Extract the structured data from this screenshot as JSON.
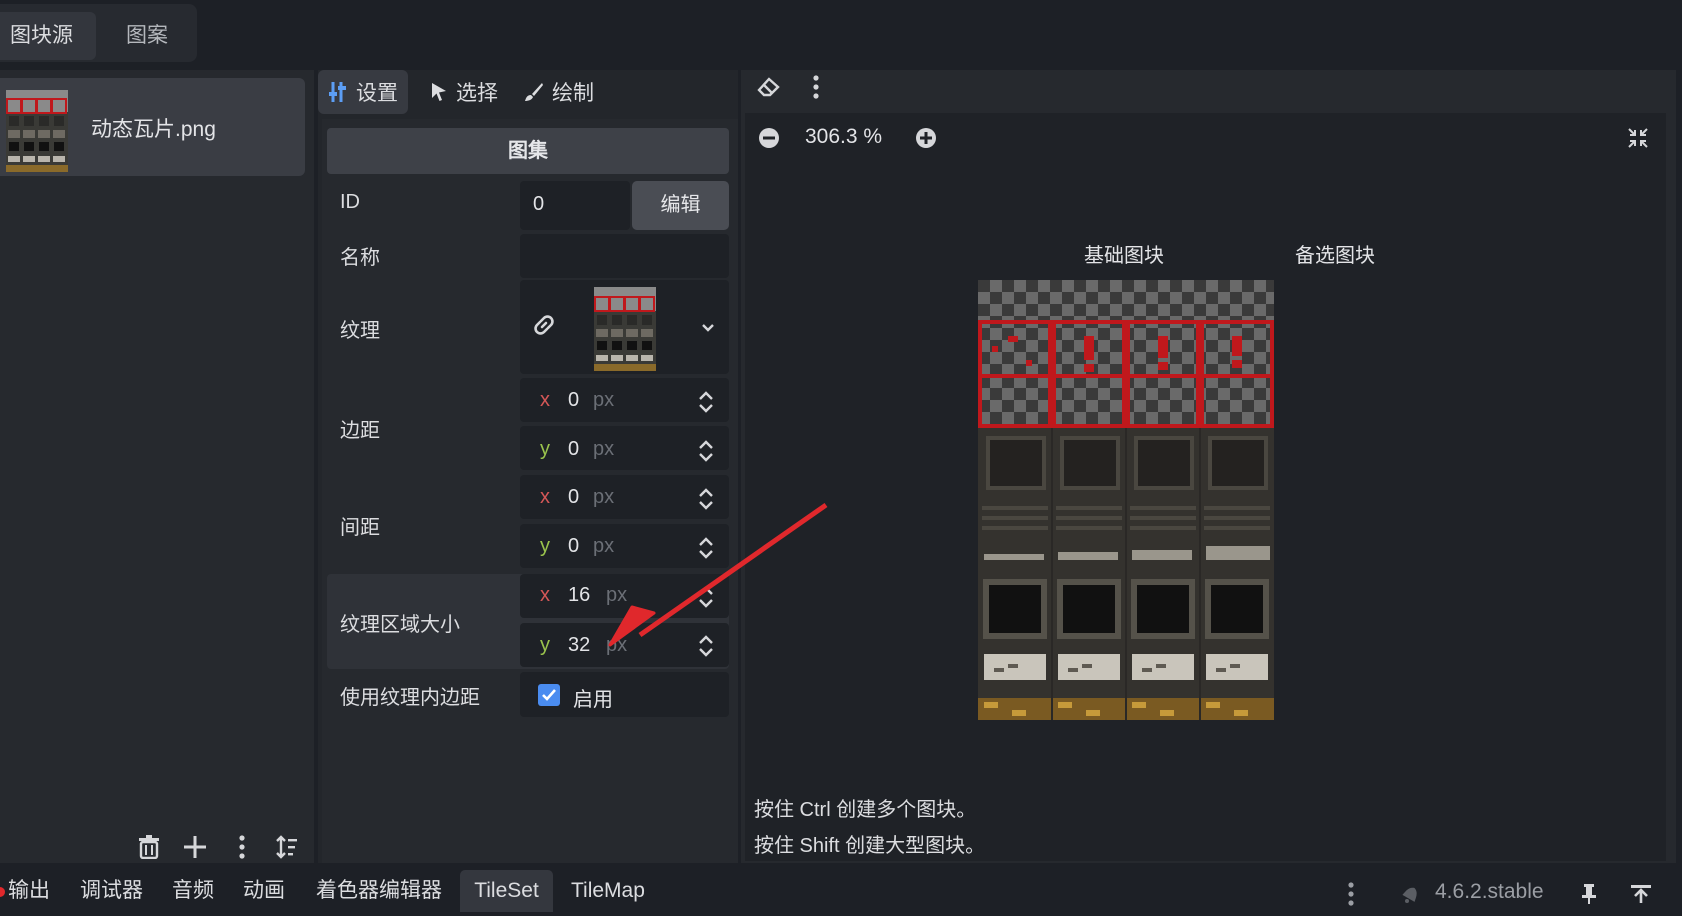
{
  "source_tabs": [
    "图块源",
    "图案"
  ],
  "atlas": {
    "name": "动态瓦片.png"
  },
  "left_toolbar": {
    "icons": [
      "trash-icon",
      "plus-icon",
      "kebab-icon",
      "sort-icon"
    ]
  },
  "mode_tabs": [
    "设置",
    "选择",
    "绘制"
  ],
  "inspector": {
    "section": "图集",
    "id_label": "ID",
    "id_value": "0",
    "edit_button": "编辑",
    "name_label": "名称",
    "texture_label": "纹理",
    "margins_label": "边距",
    "margins": {
      "x": "0",
      "y": "0"
    },
    "separation_label": "间距",
    "separation": {
      "x": "0",
      "y": "0"
    },
    "region_size_label": "纹理区域大小",
    "region_size": {
      "x": "16",
      "y": "32"
    },
    "axis_x": "x",
    "axis_y": "y",
    "unit": "px",
    "padding_label": "使用纹理内边距",
    "padding_checked": true,
    "padding_value": "启用"
  },
  "viewport": {
    "zoom": "306.3 %",
    "base_tiles_header": "基础图块",
    "alt_tiles_header": "备选图块",
    "hint_1": "按住 Ctrl 创建多个图块。",
    "hint_2": "按住 Shift 创建大型图块。"
  },
  "bottom_tabs": [
    "输出",
    "调试器",
    "音频",
    "动画",
    "着色器编辑器",
    "TileSet",
    "TileMap"
  ],
  "active_bottom_tab": "TileSet",
  "version": "4.6.2.stable",
  "colors": {
    "accent": "#4a8cf0",
    "annotation_arrow": "#e0282c",
    "axis_x": "#d45757",
    "axis_y": "#9ac34d"
  }
}
